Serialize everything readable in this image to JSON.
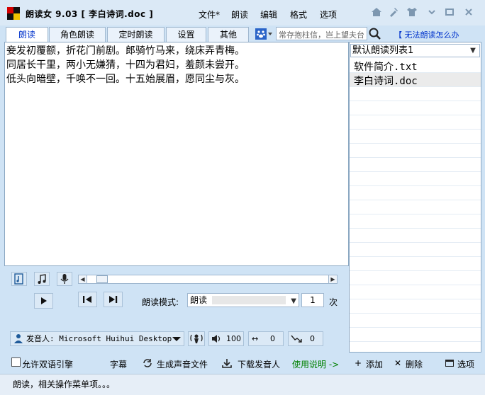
{
  "window": {
    "app_title": "朗读女 9.03 [ 李白诗词.doc ]",
    "menu": [
      "文件*",
      "朗读",
      "编辑",
      "格式",
      "选项"
    ]
  },
  "tabs": [
    "朗读",
    "角色朗读",
    "定时朗读",
    "设置",
    "其他"
  ],
  "active_tab": "朗读",
  "search": {
    "placeholder": "常存抱柱信，岂上望夫台"
  },
  "help_link": "【 无法朗读怎么办",
  "text_area": {
    "lines": [
      "妾发初覆额，折花门前剧。郎骑竹马来，绕床弄青梅。",
      "同居长干里，两小无嫌猜，十四为君妇，羞颜未尝开。",
      "低头向暗壁，千唤不一回。十五始展眉，愿同尘与灰。"
    ]
  },
  "playlist": {
    "selected": "默认朗读列表1",
    "items": [
      "软件简介.txt",
      "李白诗词.doc"
    ],
    "selected_item": "李白诗词.doc"
  },
  "controls": {
    "mode_label": "朗读模式:",
    "mode_value": "朗读",
    "repeat_count": "1",
    "repeat_unit": "次",
    "voice_label": "发音人:",
    "voice_name": "Microsoft Huihui Desktop",
    "volume": "100",
    "speed": "0",
    "pitch": "0"
  },
  "bottom": {
    "bilingual": "允许双语引擎",
    "subtitles": "字幕",
    "generate": "生成声音文件",
    "download": "下载发音人",
    "usage": "使用说明 ->",
    "add": "添加",
    "delete": "删除",
    "options": "选项"
  },
  "status": "朗读，相关操作菜单项。。。",
  "colors": {
    "accent": "#0033cc",
    "background": "#cfe3f5",
    "link_green": "#008000",
    "icon_blue": "#1f5b9a"
  }
}
